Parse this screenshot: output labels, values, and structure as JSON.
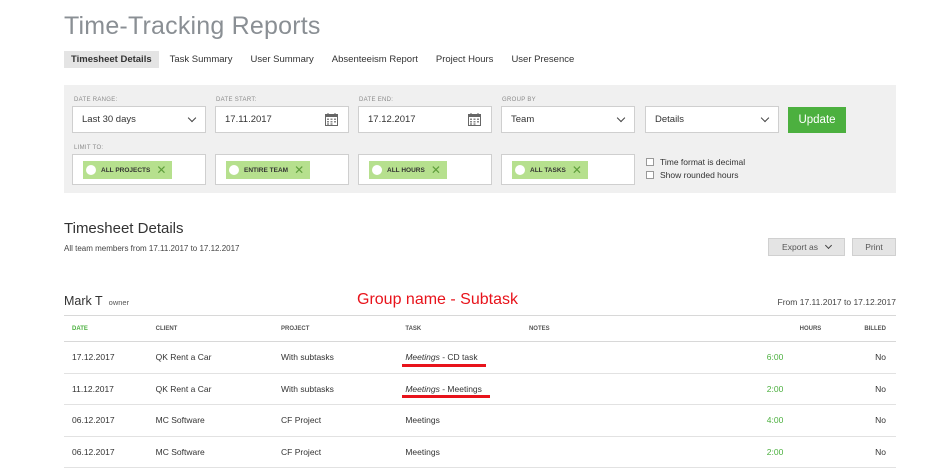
{
  "page": {
    "title": "Time-Tracking Reports"
  },
  "tabs": [
    {
      "label": "Timesheet Details",
      "active": true
    },
    {
      "label": "Task Summary",
      "active": false
    },
    {
      "label": "User Summary",
      "active": false
    },
    {
      "label": "Absenteeism Report",
      "active": false
    },
    {
      "label": "Project Hours",
      "active": false
    },
    {
      "label": "User Presence",
      "active": false
    }
  ],
  "filters": {
    "date_range": {
      "label": "DATE RANGE:",
      "value": "Last 30 days"
    },
    "date_start": {
      "label": "DATE START:",
      "value": "17.11.2017"
    },
    "date_end": {
      "label": "DATE END:",
      "value": "17.12.2017"
    },
    "group_by": {
      "label": "GROUP BY",
      "value": "Team"
    },
    "detail_level": {
      "value": "Details"
    },
    "update_label": "Update",
    "limit_label": "LIMIT TO:",
    "limits": [
      "ALL PROJECTS",
      "ENTIRE TEAM",
      "ALL HOURS",
      "ALL TASKS"
    ],
    "options": [
      "Time format is decimal",
      "Show rounded hours"
    ]
  },
  "section": {
    "title": "Timesheet Details",
    "subtitle": "All team members from 17.11.2017 to 17.12.2017",
    "export_label": "Export as",
    "print_label": "Print"
  },
  "user": {
    "name": "Mark T",
    "role": "owner",
    "range": "From 17.11.2017 to 17.12.2017"
  },
  "annotation": "Group name - Subtask",
  "table": {
    "headers": {
      "date": "DATE",
      "client": "CLIENT",
      "project": "PROJECT",
      "task": "TASK",
      "notes": "NOTES",
      "hours": "HOURS",
      "billed": "BILLED"
    },
    "rows": [
      {
        "date": "17.12.2017",
        "client": "QK Rent a Car",
        "project": "With subtasks",
        "task_group": "Meetings",
        "task_sep": " - ",
        "task": "CD task",
        "notes": "",
        "hours": "6:00",
        "billed": "No"
      },
      {
        "date": "11.12.2017",
        "client": "QK Rent a Car",
        "project": "With subtasks",
        "task_group": "Meetings",
        "task_sep": " - ",
        "task": "Meetings",
        "notes": "",
        "hours": "2:00",
        "billed": "No"
      },
      {
        "date": "06.12.2017",
        "client": "MC Software",
        "project": "CF Project",
        "task_group": "",
        "task_sep": "",
        "task": "Meetings",
        "notes": "",
        "hours": "4:00",
        "billed": "No"
      },
      {
        "date": "06.12.2017",
        "client": "MC Software",
        "project": "CF Project",
        "task_group": "",
        "task_sep": "",
        "task": "Meetings",
        "notes": "",
        "hours": "2:00",
        "billed": "No"
      }
    ]
  },
  "colors": {
    "accent_green": "#4cb03f",
    "chip_green": "#b6e08e",
    "annotation_red": "#e8131b"
  }
}
